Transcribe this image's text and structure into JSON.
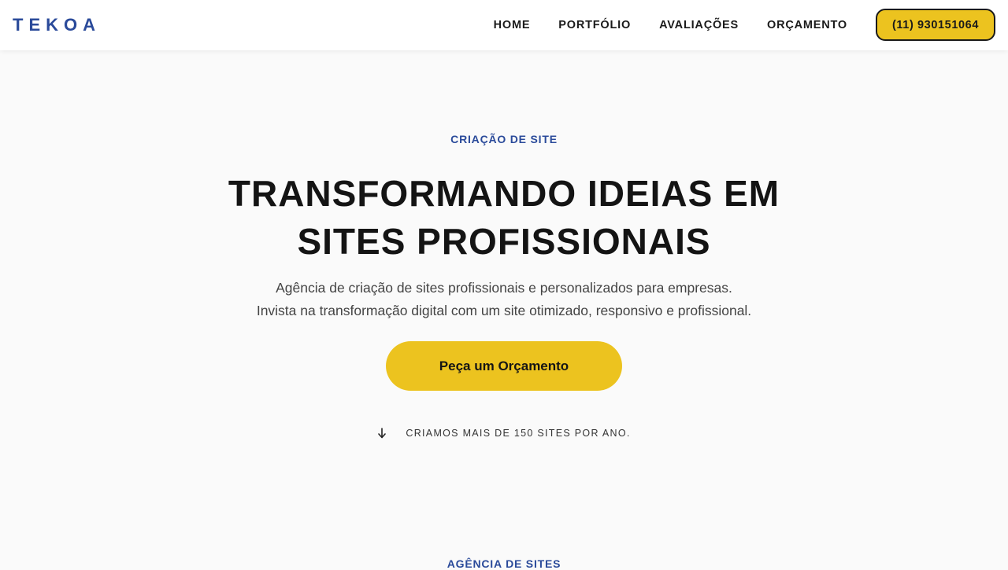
{
  "brand": {
    "logo_text": "TEKOA",
    "accent_color": "#2a4a9a",
    "highlight_color": "#ecc31f"
  },
  "nav": {
    "items": [
      {
        "label": "HOME"
      },
      {
        "label": "PORTFÓLIO"
      },
      {
        "label": "AVALIAÇÕES"
      },
      {
        "label": "ORÇAMENTO"
      }
    ],
    "phone_label": "(11) 930151064"
  },
  "hero": {
    "eyebrow": "CRIAÇÃO DE SITE",
    "headline_line1": "TRANSFORMANDO IDEIAS EM",
    "headline_line2": "SITES PROFISSIONAIS",
    "subtext_line1": "Agência de criação de sites profissionais e personalizados para empresas.",
    "subtext_line2": "Invista na transformação digital com um site otimizado, responsivo e profissional.",
    "cta_label": "Peça um Orçamento",
    "stat_icon": "arrow-down-icon",
    "stat_text": "CRIAMOS MAIS DE 150 SITES POR ANO."
  },
  "next_section": {
    "eyebrow": "AGÊNCIA DE SITES"
  }
}
